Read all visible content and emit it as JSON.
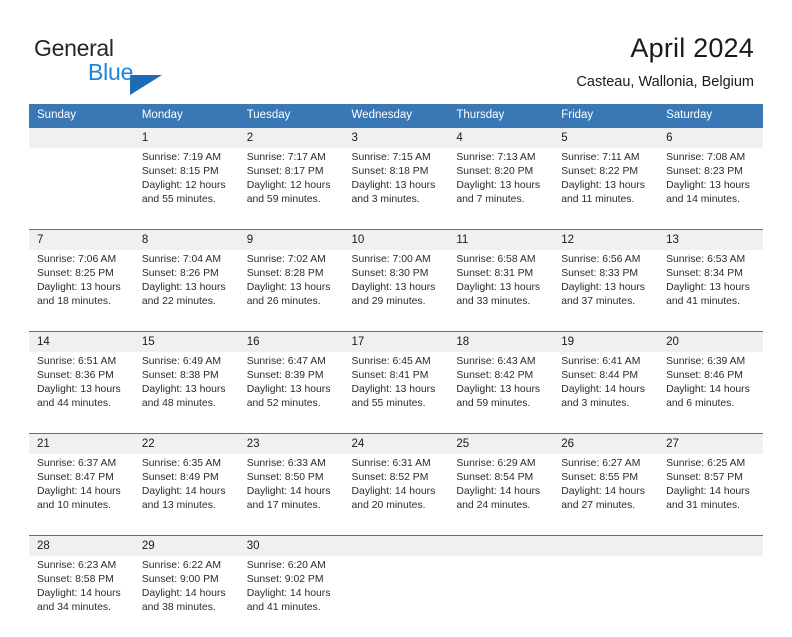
{
  "brand": {
    "name_top": "General",
    "name_bottom": "Blue",
    "triangle_color": "#1c6cb5",
    "top_color": "#262626",
    "bottom_color": "#1f85d6"
  },
  "header": {
    "title": "April 2024",
    "subtitle": "Casteau, Wallonia, Belgium"
  },
  "theme": {
    "header_blue": "#3978b5",
    "number_band": "#f0f0f0",
    "text": "#2b2b2b"
  },
  "calendar": {
    "weekday_headers": [
      "Sunday",
      "Monday",
      "Tuesday",
      "Wednesday",
      "Thursday",
      "Friday",
      "Saturday"
    ],
    "weeks": [
      [
        {
          "day": "",
          "sunrise": "",
          "sunset": "",
          "daylight_line1": "",
          "daylight_line2": ""
        },
        {
          "day": "1",
          "sunrise": "Sunrise: 7:19 AM",
          "sunset": "Sunset: 8:15 PM",
          "daylight_line1": "Daylight: 12 hours",
          "daylight_line2": "and 55 minutes."
        },
        {
          "day": "2",
          "sunrise": "Sunrise: 7:17 AM",
          "sunset": "Sunset: 8:17 PM",
          "daylight_line1": "Daylight: 12 hours",
          "daylight_line2": "and 59 minutes."
        },
        {
          "day": "3",
          "sunrise": "Sunrise: 7:15 AM",
          "sunset": "Sunset: 8:18 PM",
          "daylight_line1": "Daylight: 13 hours",
          "daylight_line2": "and 3 minutes."
        },
        {
          "day": "4",
          "sunrise": "Sunrise: 7:13 AM",
          "sunset": "Sunset: 8:20 PM",
          "daylight_line1": "Daylight: 13 hours",
          "daylight_line2": "and 7 minutes."
        },
        {
          "day": "5",
          "sunrise": "Sunrise: 7:11 AM",
          "sunset": "Sunset: 8:22 PM",
          "daylight_line1": "Daylight: 13 hours",
          "daylight_line2": "and 11 minutes."
        },
        {
          "day": "6",
          "sunrise": "Sunrise: 7:08 AM",
          "sunset": "Sunset: 8:23 PM",
          "daylight_line1": "Daylight: 13 hours",
          "daylight_line2": "and 14 minutes."
        }
      ],
      [
        {
          "day": "7",
          "sunrise": "Sunrise: 7:06 AM",
          "sunset": "Sunset: 8:25 PM",
          "daylight_line1": "Daylight: 13 hours",
          "daylight_line2": "and 18 minutes."
        },
        {
          "day": "8",
          "sunrise": "Sunrise: 7:04 AM",
          "sunset": "Sunset: 8:26 PM",
          "daylight_line1": "Daylight: 13 hours",
          "daylight_line2": "and 22 minutes."
        },
        {
          "day": "9",
          "sunrise": "Sunrise: 7:02 AM",
          "sunset": "Sunset: 8:28 PM",
          "daylight_line1": "Daylight: 13 hours",
          "daylight_line2": "and 26 minutes."
        },
        {
          "day": "10",
          "sunrise": "Sunrise: 7:00 AM",
          "sunset": "Sunset: 8:30 PM",
          "daylight_line1": "Daylight: 13 hours",
          "daylight_line2": "and 29 minutes."
        },
        {
          "day": "11",
          "sunrise": "Sunrise: 6:58 AM",
          "sunset": "Sunset: 8:31 PM",
          "daylight_line1": "Daylight: 13 hours",
          "daylight_line2": "and 33 minutes."
        },
        {
          "day": "12",
          "sunrise": "Sunrise: 6:56 AM",
          "sunset": "Sunset: 8:33 PM",
          "daylight_line1": "Daylight: 13 hours",
          "daylight_line2": "and 37 minutes."
        },
        {
          "day": "13",
          "sunrise": "Sunrise: 6:53 AM",
          "sunset": "Sunset: 8:34 PM",
          "daylight_line1": "Daylight: 13 hours",
          "daylight_line2": "and 41 minutes."
        }
      ],
      [
        {
          "day": "14",
          "sunrise": "Sunrise: 6:51 AM",
          "sunset": "Sunset: 8:36 PM",
          "daylight_line1": "Daylight: 13 hours",
          "daylight_line2": "and 44 minutes."
        },
        {
          "day": "15",
          "sunrise": "Sunrise: 6:49 AM",
          "sunset": "Sunset: 8:38 PM",
          "daylight_line1": "Daylight: 13 hours",
          "daylight_line2": "and 48 minutes."
        },
        {
          "day": "16",
          "sunrise": "Sunrise: 6:47 AM",
          "sunset": "Sunset: 8:39 PM",
          "daylight_line1": "Daylight: 13 hours",
          "daylight_line2": "and 52 minutes."
        },
        {
          "day": "17",
          "sunrise": "Sunrise: 6:45 AM",
          "sunset": "Sunset: 8:41 PM",
          "daylight_line1": "Daylight: 13 hours",
          "daylight_line2": "and 55 minutes."
        },
        {
          "day": "18",
          "sunrise": "Sunrise: 6:43 AM",
          "sunset": "Sunset: 8:42 PM",
          "daylight_line1": "Daylight: 13 hours",
          "daylight_line2": "and 59 minutes."
        },
        {
          "day": "19",
          "sunrise": "Sunrise: 6:41 AM",
          "sunset": "Sunset: 8:44 PM",
          "daylight_line1": "Daylight: 14 hours",
          "daylight_line2": "and 3 minutes."
        },
        {
          "day": "20",
          "sunrise": "Sunrise: 6:39 AM",
          "sunset": "Sunset: 8:46 PM",
          "daylight_line1": "Daylight: 14 hours",
          "daylight_line2": "and 6 minutes."
        }
      ],
      [
        {
          "day": "21",
          "sunrise": "Sunrise: 6:37 AM",
          "sunset": "Sunset: 8:47 PM",
          "daylight_line1": "Daylight: 14 hours",
          "daylight_line2": "and 10 minutes."
        },
        {
          "day": "22",
          "sunrise": "Sunrise: 6:35 AM",
          "sunset": "Sunset: 8:49 PM",
          "daylight_line1": "Daylight: 14 hours",
          "daylight_line2": "and 13 minutes."
        },
        {
          "day": "23",
          "sunrise": "Sunrise: 6:33 AM",
          "sunset": "Sunset: 8:50 PM",
          "daylight_line1": "Daylight: 14 hours",
          "daylight_line2": "and 17 minutes."
        },
        {
          "day": "24",
          "sunrise": "Sunrise: 6:31 AM",
          "sunset": "Sunset: 8:52 PM",
          "daylight_line1": "Daylight: 14 hours",
          "daylight_line2": "and 20 minutes."
        },
        {
          "day": "25",
          "sunrise": "Sunrise: 6:29 AM",
          "sunset": "Sunset: 8:54 PM",
          "daylight_line1": "Daylight: 14 hours",
          "daylight_line2": "and 24 minutes."
        },
        {
          "day": "26",
          "sunrise": "Sunrise: 6:27 AM",
          "sunset": "Sunset: 8:55 PM",
          "daylight_line1": "Daylight: 14 hours",
          "daylight_line2": "and 27 minutes."
        },
        {
          "day": "27",
          "sunrise": "Sunrise: 6:25 AM",
          "sunset": "Sunset: 8:57 PM",
          "daylight_line1": "Daylight: 14 hours",
          "daylight_line2": "and 31 minutes."
        }
      ],
      [
        {
          "day": "28",
          "sunrise": "Sunrise: 6:23 AM",
          "sunset": "Sunset: 8:58 PM",
          "daylight_line1": "Daylight: 14 hours",
          "daylight_line2": "and 34 minutes."
        },
        {
          "day": "29",
          "sunrise": "Sunrise: 6:22 AM",
          "sunset": "Sunset: 9:00 PM",
          "daylight_line1": "Daylight: 14 hours",
          "daylight_line2": "and 38 minutes."
        },
        {
          "day": "30",
          "sunrise": "Sunrise: 6:20 AM",
          "sunset": "Sunset: 9:02 PM",
          "daylight_line1": "Daylight: 14 hours",
          "daylight_line2": "and 41 minutes."
        },
        {
          "day": "",
          "sunrise": "",
          "sunset": "",
          "daylight_line1": "",
          "daylight_line2": ""
        },
        {
          "day": "",
          "sunrise": "",
          "sunset": "",
          "daylight_line1": "",
          "daylight_line2": ""
        },
        {
          "day": "",
          "sunrise": "",
          "sunset": "",
          "daylight_line1": "",
          "daylight_line2": ""
        },
        {
          "day": "",
          "sunrise": "",
          "sunset": "",
          "daylight_line1": "",
          "daylight_line2": ""
        }
      ]
    ]
  }
}
